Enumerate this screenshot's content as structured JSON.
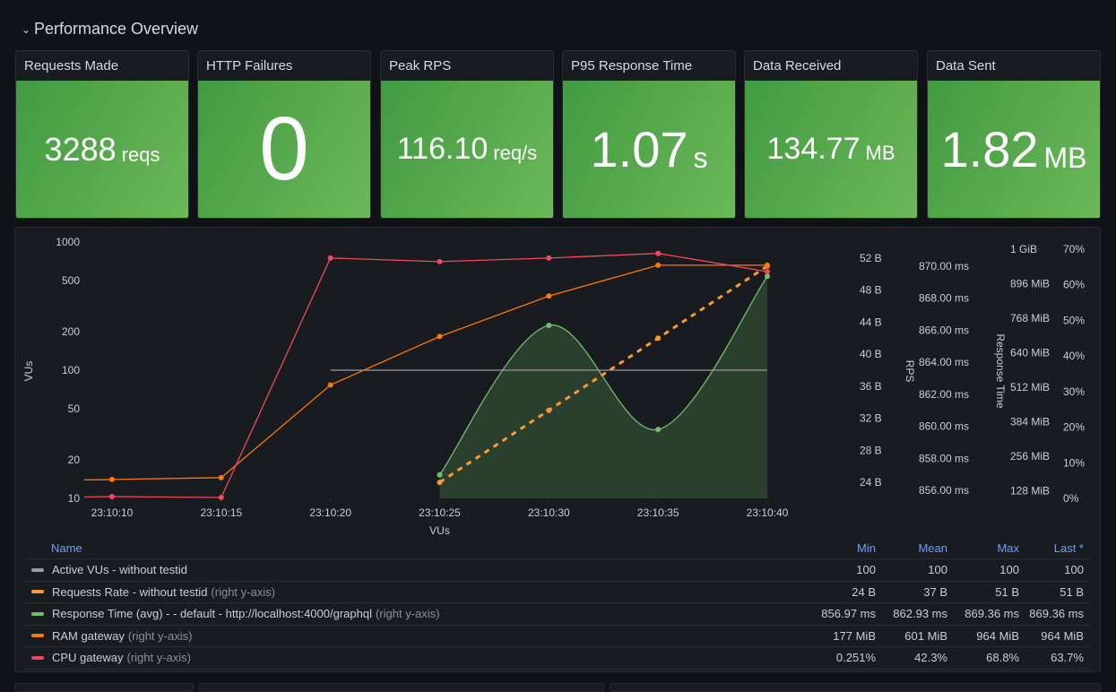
{
  "row": {
    "title": "Performance Overview",
    "collapse_icon": "chevron-down-icon"
  },
  "stats": [
    {
      "title": "Requests Made",
      "value": "3288",
      "unit": "reqs"
    },
    {
      "title": "HTTP Failures",
      "value": "0",
      "unit": ""
    },
    {
      "title": "Peak RPS",
      "value": "116.10",
      "unit": "req/s"
    },
    {
      "title": "P95 Response Time",
      "value": "1.07",
      "unit": "s"
    },
    {
      "title": "Data Received",
      "value": "134.77",
      "unit": "MB"
    },
    {
      "title": "Data Sent",
      "value": "1.82",
      "unit": "MB"
    }
  ],
  "colors": {
    "stat_bg": "#56a64b",
    "gray": "#9a9aa0",
    "orange": "#ff780a",
    "green": "#73bf69",
    "red": "#f2495c",
    "yellow_orange": "#ff9830",
    "legend_header": "#6e9fff"
  },
  "chart_data": {
    "type": "line",
    "title": "",
    "xlabel": "VUs",
    "x": [
      "23:10:10",
      "23:10:15",
      "23:10:20",
      "23:10:25",
      "23:10:30",
      "23:10:35",
      "23:10:40"
    ],
    "axes": {
      "left": {
        "label": "VUs",
        "scale": "log",
        "ticks": [
          "10",
          "20",
          "50",
          "100",
          "200",
          "500",
          "1000"
        ],
        "range": [
          10,
          1000
        ]
      },
      "right1": {
        "label": "",
        "ticks": [
          "24 B",
          "28 B",
          "32 B",
          "36 B",
          "40 B",
          "44 B",
          "48 B",
          "52 B"
        ],
        "range": [
          22,
          54
        ]
      },
      "right2": {
        "label": "RPS",
        "ticks": [
          "856.00 ms",
          "858.00 ms",
          "860.00 ms",
          "862.00 ms",
          "864.00 ms",
          "866.00 ms",
          "868.00 ms",
          "870.00 ms"
        ],
        "range": [
          855.5,
          871.5
        ]
      },
      "right3": {
        "label": "Response Time",
        "ticks": [
          "128 MiB",
          "256 MiB",
          "384 MiB",
          "512 MiB",
          "640 MiB",
          "768 MiB",
          "896 MiB",
          "1 GiB"
        ],
        "range": [
          100,
          1050
        ]
      },
      "right4": {
        "label": "",
        "ticks": [
          "0%",
          "10%",
          "20%",
          "30%",
          "40%",
          "50%",
          "60%",
          "70%"
        ],
        "range": [
          0,
          72
        ]
      }
    },
    "series": [
      {
        "name": "Active VUs - without testid",
        "axis": "left",
        "color": "#9a9aa0",
        "values": [
          null,
          null,
          100,
          100,
          100,
          100,
          100
        ],
        "points": false
      },
      {
        "name": "Requests Rate - without testid",
        "axis": "right1",
        "color": "#ff9830",
        "dashed": true,
        "values": [
          null,
          null,
          null,
          24,
          33,
          42,
          51
        ]
      },
      {
        "name": "Response Time (avg) - - default - http://localhost:4000/graphql",
        "axis": "right2",
        "color": "#73bf69",
        "fill": true,
        "smooth": true,
        "values": [
          null,
          null,
          null,
          856.97,
          866.3,
          859.8,
          869.36
        ]
      },
      {
        "name": "RAM gateway",
        "axis": "right3",
        "color": "#ff780a",
        "values": [
          170,
          177,
          520,
          700,
          850,
          964,
          964
        ]
      },
      {
        "name": "CPU gateway",
        "axis": "right4",
        "color": "#f2495c",
        "values": [
          0.5,
          0.251,
          67.5,
          66.5,
          67.5,
          68.8,
          63.7
        ]
      }
    ]
  },
  "legend": {
    "headers": {
      "name": "Name",
      "min": "Min",
      "mean": "Mean",
      "max": "Max",
      "last": "Last *"
    },
    "rows": [
      {
        "name": "Active VUs - without testid",
        "suffix": "",
        "color": "#9a9aa0",
        "min": "100",
        "mean": "100",
        "max": "100",
        "last": "100"
      },
      {
        "name": "Requests Rate - without testid",
        "suffix": "(right y-axis)",
        "color": "#ff9830",
        "min": "24 B",
        "mean": "37 B",
        "max": "51 B",
        "last": "51 B"
      },
      {
        "name": "Response Time (avg) - - default - http://localhost:4000/graphql",
        "suffix": "(right y-axis)",
        "color": "#73bf69",
        "min": "856.97 ms",
        "mean": "862.93 ms",
        "max": "869.36 ms",
        "last": "869.36 ms"
      },
      {
        "name": "RAM gateway",
        "suffix": "(right y-axis)",
        "color": "#ff780a",
        "min": "177 MiB",
        "mean": "601 MiB",
        "max": "964 MiB",
        "last": "964 MiB"
      },
      {
        "name": "CPU gateway",
        "suffix": "(right y-axis)",
        "color": "#f2495c",
        "min": "0.251%",
        "mean": "42.3%",
        "max": "68.8%",
        "last": "63.7%"
      }
    ]
  }
}
